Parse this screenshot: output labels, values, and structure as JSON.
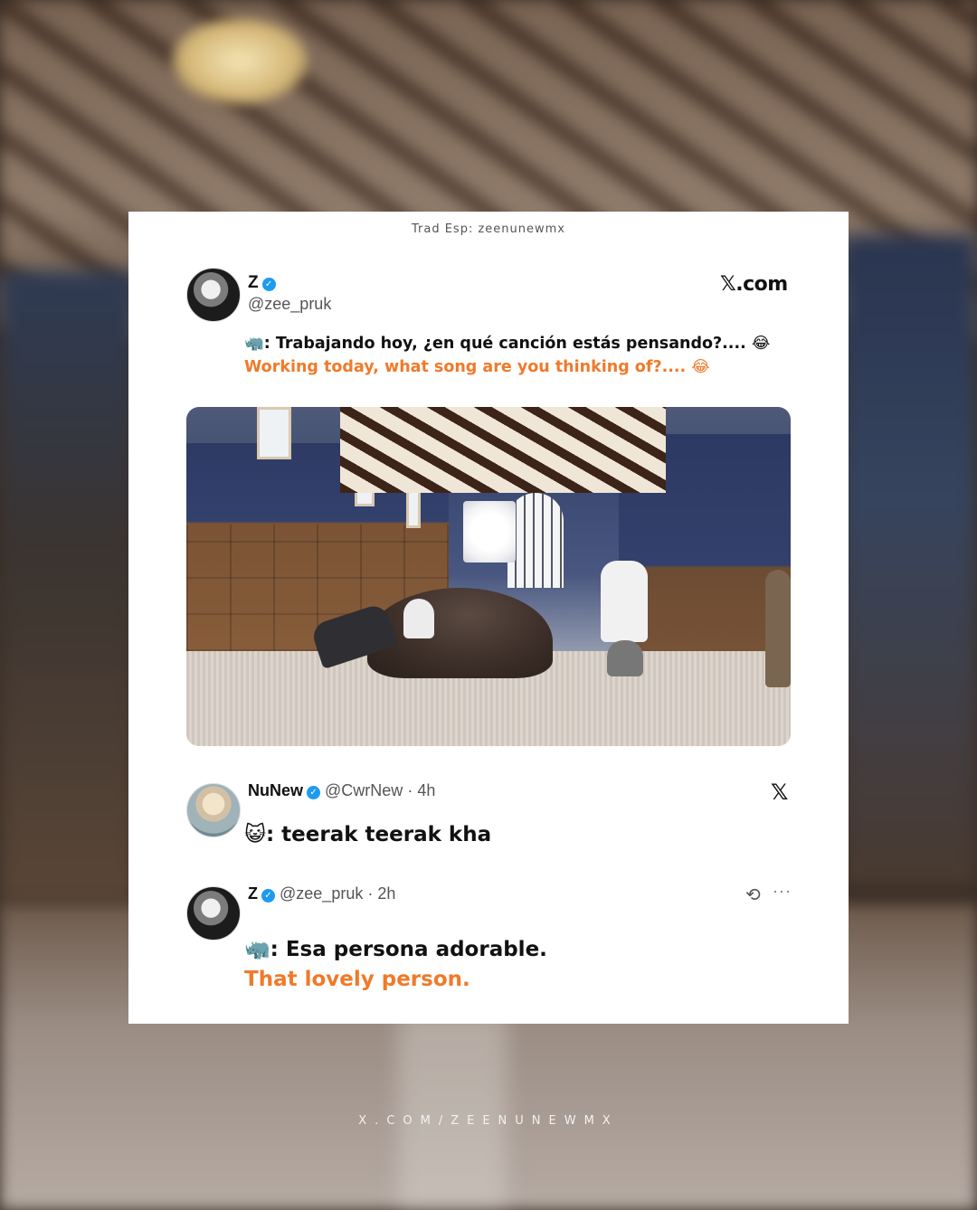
{
  "credit": "Trad Esp: zeenunewmx",
  "post": {
    "author": {
      "name": "Z",
      "handle": "@zee_pruk",
      "verified": true,
      "avatar": "zee-avatar"
    },
    "source_label": "𝕏.com",
    "text_es": "🦏: Trabajando hoy, ¿en qué canción estás pensando?.... 😂",
    "text_en": "Working today, what song are you thinking of?.... 😂",
    "media": "photo-film-set-hall"
  },
  "reply1": {
    "name": "NuNew",
    "handle": "@CwrNew",
    "time": "4h",
    "verified": true,
    "avatar": "nunew-avatar",
    "text": "😺: teerak teerak kha",
    "source_icon": "𝕏"
  },
  "reply2": {
    "name": "Z",
    "handle": "@zee_pruk",
    "time": "2h",
    "verified": true,
    "avatar": "zee-avatar",
    "text_es": "🦏: Esa persona adorable.",
    "text_en": "That lovely person.",
    "icons": [
      "retweet-icon",
      "more-icon"
    ],
    "more_label": "···"
  },
  "footer": "X.COM/ZEENUNEWMX",
  "colors": {
    "accent": "#f07a2a",
    "verified": "#1d9bf0",
    "card": "#ffffff"
  }
}
